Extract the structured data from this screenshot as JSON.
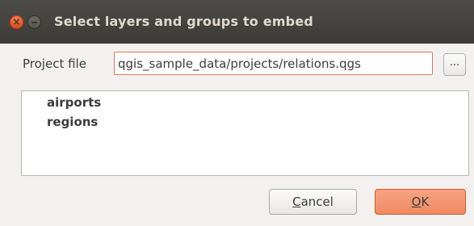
{
  "window": {
    "title": "Select layers and groups to embed",
    "close_glyph": "×"
  },
  "project": {
    "label": "Project file",
    "value": "qgis_sample_data/projects/relations.qgs",
    "browse_label": "..."
  },
  "tree": {
    "items": [
      "airports",
      "regions"
    ]
  },
  "buttons": {
    "cancel_mnemonic": "C",
    "cancel_rest": "ancel",
    "ok_mnemonic": "O",
    "ok_rest": "K"
  },
  "colors": {
    "titlebar": "#3c3b37",
    "accent": "#f08a62",
    "close": "#df4a16"
  },
  "icons": {
    "close": "close-icon",
    "minimize": "minimize-icon"
  }
}
